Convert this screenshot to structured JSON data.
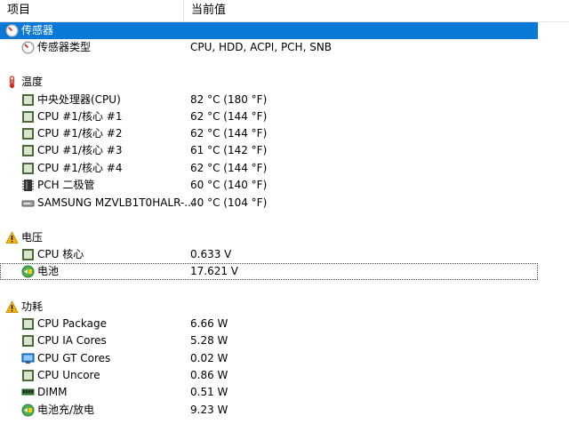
{
  "header": {
    "col_item": "项目",
    "col_value": "当前值"
  },
  "sections": {
    "sensor": {
      "title": "传感器",
      "rows": [
        {
          "label": "传感器类型",
          "value": "CPU, HDD, ACPI, PCH, SNB"
        }
      ]
    },
    "temperature": {
      "title": "温度",
      "rows": [
        {
          "label": "中央处理器(CPU)",
          "value": "82 °C  (180 °F)"
        },
        {
          "label": "CPU #1/核心 #1",
          "value": "62 °C  (144 °F)"
        },
        {
          "label": "CPU #1/核心 #2",
          "value": "62 °C  (144 °F)"
        },
        {
          "label": "CPU #1/核心 #3",
          "value": "61 °C  (142 °F)"
        },
        {
          "label": "CPU #1/核心 #4",
          "value": "62 °C  (144 °F)"
        },
        {
          "label": "PCH 二极管",
          "value": "60 °C  (140 °F)"
        },
        {
          "label": "SAMSUNG MZVLB1T0HALR-...",
          "value": "40 °C  (104 °F)"
        }
      ]
    },
    "voltage": {
      "title": "电压",
      "rows": [
        {
          "label": "CPU 核心",
          "value": "0.633 V"
        },
        {
          "label": "电池",
          "value": "17.621 V"
        }
      ]
    },
    "power": {
      "title": "功耗",
      "rows": [
        {
          "label": "CPU Package",
          "value": "6.66 W"
        },
        {
          "label": "CPU IA Cores",
          "value": "5.28 W"
        },
        {
          "label": "CPU GT Cores",
          "value": "0.02 W"
        },
        {
          "label": "CPU Uncore",
          "value": "0.86 W"
        },
        {
          "label": "DIMM",
          "value": "0.51 W"
        },
        {
          "label": "电池充/放电",
          "value": "9.23 W"
        }
      ]
    }
  },
  "colors": {
    "selection": "#0a78d7",
    "chip_border": "#4a6a3a",
    "warning": "#f2b705",
    "thermometer": "#d52b1e"
  },
  "icons": {
    "sensor": "sensor-gauge-icon",
    "temperature": "thermometer-icon",
    "voltage": "warning-icon",
    "power": "warning-icon",
    "chip": "chip-icon",
    "pch": "pch-chip-icon",
    "ssd": "ssd-icon",
    "battery": "battery-icon",
    "gpu": "gpu-icon",
    "dimm": "dimm-icon"
  }
}
